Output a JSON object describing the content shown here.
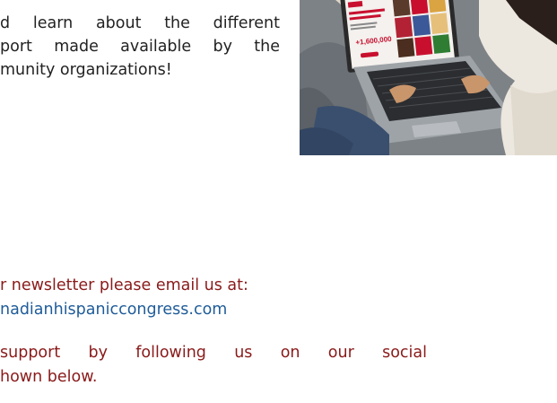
{
  "intro": {
    "line1": "d learn about the different",
    "line2": "port made available by the",
    "line3": "munity organizations!"
  },
  "photo": {
    "screen_amount": "+1,600,000",
    "skin_color": "#c9956b",
    "sweater_color": "#ece7df",
    "laptop_color": "#9ea3a8"
  },
  "newsletter": {
    "label": "r newsletter please email us at:",
    "email": "nadianhispaniccongress.com"
  },
  "social": {
    "line1": "support by following us on our social",
    "line2": "hown below."
  },
  "colors": {
    "accent_red": "#8a1a1a",
    "link_blue": "#1f5c99"
  }
}
